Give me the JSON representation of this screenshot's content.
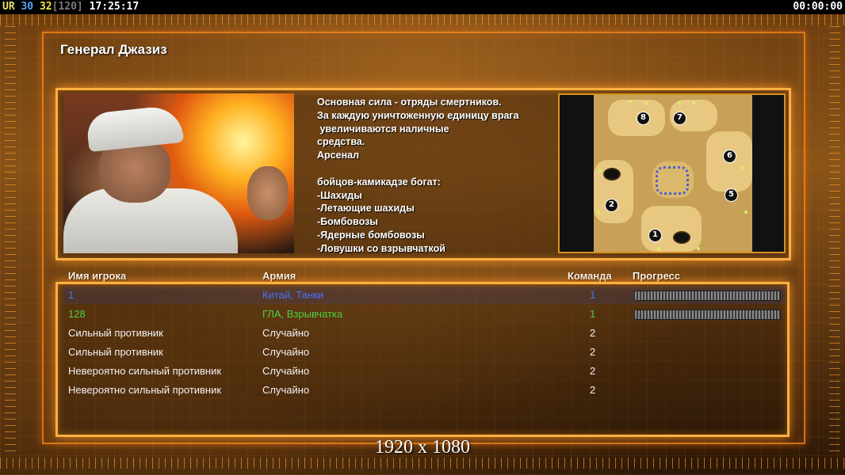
{
  "hud": {
    "ur": "UR",
    "val_a": "30",
    "val_b": "32",
    "val_c": "[120]",
    "time": "17:25:17",
    "timer": "00:00:00"
  },
  "general": {
    "title": "Генерал Джазиз",
    "description": "Основная сила - отряды смертников.\nЗа каждую уничтоженную единицу врага\n увеличиваются наличные\nсредства.\nАрсенал\n\nбойцов-камикадзе богат:\n-Шахиды\n-Летающие шахиды\n-Бомбовозы\n-Ядерные бомбовозы\n-Ловушки со взрывчаткой"
  },
  "map": {
    "start_positions": [
      "1",
      "2",
      "5",
      "6",
      "7",
      "8"
    ]
  },
  "table": {
    "headers": {
      "name": "Имя игрока",
      "army": "Армия",
      "team": "Команда",
      "progress": "Прогресс"
    },
    "rows": [
      {
        "name": "1",
        "army": "Китай, Танки",
        "team": "1",
        "color": "#4a70ff",
        "progress": 1.0
      },
      {
        "name": "128",
        "army": "ГЛА, Взрывчатка",
        "team": "1",
        "color": "#4ad040",
        "progress": 1.0
      },
      {
        "name": "Сильный противник",
        "army": "Случайно",
        "team": "2",
        "color": "#f2f2f2"
      },
      {
        "name": "Сильный противник",
        "army": "Случайно",
        "team": "2",
        "color": "#f2f2f2"
      },
      {
        "name": "Невероятно сильный противник",
        "army": "Случайно",
        "team": "2",
        "color": "#f2f2f2"
      },
      {
        "name": "Невероятно сильный противник",
        "army": "Случайно",
        "team": "2",
        "color": "#f2f2f2"
      }
    ]
  },
  "overlay": {
    "resolution": "1920 x 1080"
  },
  "colors": {
    "accent": "#ffb040",
    "player_blue": "#4a70ff",
    "player_green": "#4ad040"
  }
}
